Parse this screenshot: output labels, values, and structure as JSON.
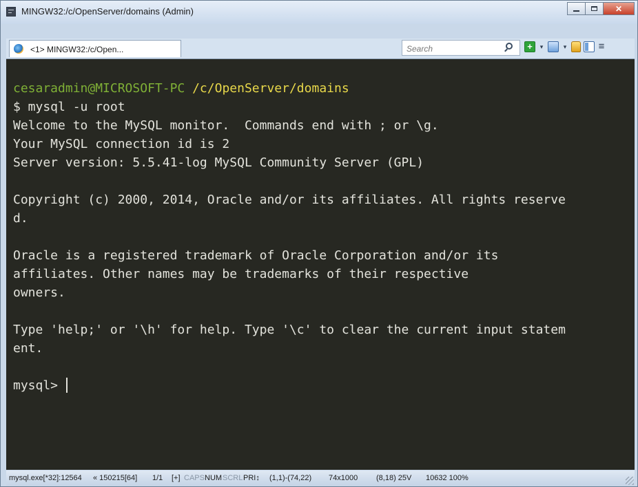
{
  "window": {
    "title": "MINGW32:/c/OpenServer/domains (Admin)",
    "close_glyph": "✕"
  },
  "tabbar": {
    "active_tab": "<1> MINGW32:/c/Open...",
    "search_placeholder": "Search",
    "add_glyph": "+",
    "dropdown_glyph": "▾",
    "menu_glyph": "≡"
  },
  "console": {
    "prompt_user": "cesaradmin@MICROSOFT-PC",
    "prompt_path": "/c/OpenServer/domains",
    "lines": [
      "$ mysql -u root",
      "Welcome to the MySQL monitor.  Commands end with ; or \\g.",
      "Your MySQL connection id is 2",
      "Server version: 5.5.41-log MySQL Community Server (GPL)",
      "",
      "Copyright (c) 2000, 2014, Oracle and/or its affiliates. All rights reserve",
      "d.",
      "",
      "Oracle is a registered trademark of Oracle Corporation and/or its",
      "affiliates. Other names may be trademarks of their respective",
      "owners.",
      "",
      "Type 'help;' or '\\h' for help. Type '\\c' to clear the current input statem",
      "ent.",
      ""
    ],
    "input_prompt": "mysql> "
  },
  "statusbar": {
    "process": "mysql.exe[*32]:12564",
    "build": "« 150215[64]",
    "console_index": "1/1",
    "plus": "[+]",
    "caps": "CAPS",
    "num": "NUM",
    "scrl": "SCRL",
    "pri": "PRI↕",
    "region": "(1,1)-(74,22)",
    "buffer": "74x1000",
    "cursor_pos": "(8,18) 25V",
    "pid_zoom": "10632 100%"
  },
  "colors": {
    "console_bg": "#272822",
    "console_fg": "#e3e3dc",
    "prompt_user": "#7fb036",
    "prompt_path": "#e8d84a"
  }
}
